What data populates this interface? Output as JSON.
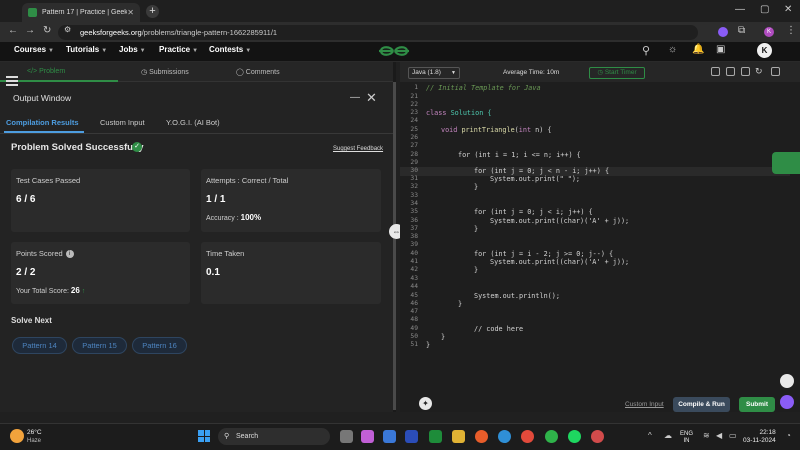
{
  "browser": {
    "tab_title": "Pattern 17 | Practice | GeeksforG",
    "url_domain": "geeksforgeeks.org",
    "url_path": "/problems/triangle-pattern-1662285911/1",
    "avatar_letter": "K"
  },
  "site_nav": {
    "items": [
      "Courses",
      "Tutorials",
      "Jobs",
      "Practice",
      "Contests"
    ],
    "avatar_letter": "K"
  },
  "problem_tabs": [
    "Problem",
    "Submissions",
    "Comments"
  ],
  "output_window": {
    "title": "Output Window",
    "tabs": [
      "Compilation Results",
      "Custom Input",
      "Y.O.G.I. (AI Bot)"
    ],
    "status": "Problem Solved Successfully",
    "feedback_link": "Suggest Feedback",
    "cards": {
      "test_cases_label": "Test Cases Passed",
      "test_cases_value": "6 / 6",
      "attempts_label": "Attempts : Correct / Total",
      "attempts_value": "1 / 1",
      "accuracy_label": "Accuracy :",
      "accuracy_value": "100%",
      "points_label": "Points Scored",
      "points_value": "2 / 2",
      "total_score_label": "Your Total Score:",
      "total_score_value": "26",
      "time_label": "Time Taken",
      "time_value": "0.1"
    },
    "solve_next_label": "Solve Next",
    "solve_next": [
      "Pattern 14",
      "Pattern 15",
      "Pattern 16"
    ]
  },
  "editor": {
    "language": "Java (1.8)",
    "avg_time": "Average Time: 10m",
    "timer_label": "Start Timer",
    "first_line_comment": "// Initial Template for Java",
    "line_numbers": [
      "1",
      "21",
      "22",
      "23",
      "24",
      "25",
      "26",
      "27",
      "28",
      "29",
      "30",
      "31",
      "32",
      "33",
      "34",
      "35",
      "36",
      "37",
      "38",
      "39",
      "40",
      "41",
      "42",
      "43",
      "44",
      "45",
      "46",
      "47",
      "48",
      "49",
      "50",
      "51"
    ],
    "code": {
      "l23a": "class",
      "l23b": "Solution {",
      "l25a": "void",
      "l25b": "printTriangle",
      "l25c": "(",
      "l25d": "int",
      "l25e": " n) {",
      "l28": "for (int i = 1; i <= n; i++) {",
      "l30": "for (int j = 0; j < n - i; j++) {",
      "l31": "System.out.print(\" \");",
      "l32": "}",
      "l35": "for (int j = 0; j < i; j++) {",
      "l36": "System.out.print((char)('A' + j));",
      "l37": "}",
      "l40": "for (int j = i - 2; j >= 0; j--) {",
      "l41": "System.out.print((char)('A' + j));",
      "l42": "}",
      "l45": "System.out.println();",
      "l46": "}",
      "l49": "// code here",
      "l50": "}",
      "l51": "}"
    },
    "custom_input": "Custom Input",
    "compile_run": "Compile & Run",
    "submit": "Submit"
  },
  "taskbar": {
    "weather_temp": "26°C",
    "weather_cond": "Haze",
    "search_placeholder": "Search",
    "lang_top": "ENG",
    "lang_bottom": "IN",
    "time": "22:18",
    "date": "03-11-2024"
  },
  "colors": {
    "accent_green": "#2f8d46",
    "link_blue": "#4d9de0"
  }
}
